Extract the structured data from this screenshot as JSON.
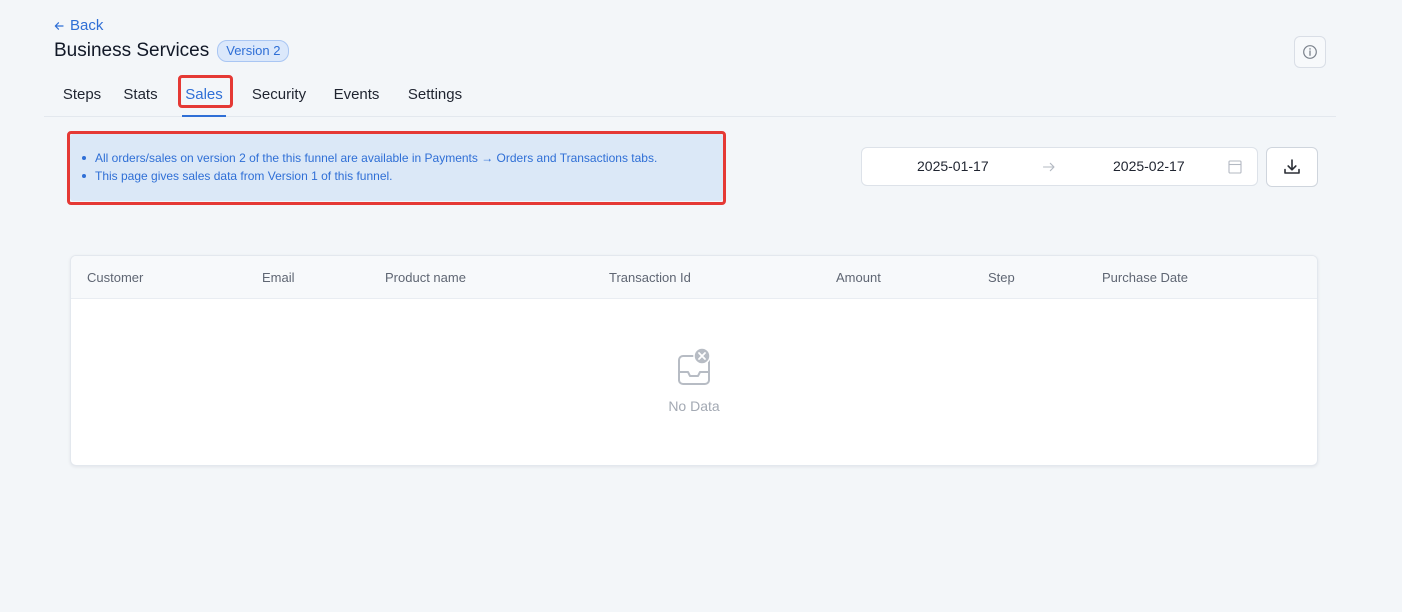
{
  "header": {
    "back_label": "Back",
    "title": "Business Services",
    "version_badge": "Version 2"
  },
  "tabs": [
    {
      "label": "Steps",
      "active": false
    },
    {
      "label": "Stats",
      "active": false
    },
    {
      "label": "Sales",
      "active": true
    },
    {
      "label": "Security",
      "active": false
    },
    {
      "label": "Events",
      "active": false
    },
    {
      "label": "Settings",
      "active": false
    }
  ],
  "notice": {
    "items": [
      "All orders/sales on version 2 of the this funnel are available in Payments → Orders and Transactions tabs.",
      "This page gives sales data from Version 1 of this funnel."
    ]
  },
  "date_range": {
    "start": "2025-01-17",
    "end": "2025-02-17"
  },
  "table": {
    "columns": [
      "Customer",
      "Email",
      "Product name",
      "Transaction Id",
      "Amount",
      "Step",
      "Purchase Date"
    ],
    "rows": [],
    "empty_text": "No Data"
  },
  "icons": {
    "back": "arrow-left-icon",
    "info": "info-icon",
    "range_separator": "arrow-right-icon",
    "calendar": "calendar-icon",
    "download": "download-icon",
    "empty": "inbox-empty-icon"
  },
  "colors": {
    "accent": "#2f6fd6",
    "highlight": "#e53935",
    "notice_bg": "#dbe8f7",
    "page_bg": "#f3f6f9"
  }
}
